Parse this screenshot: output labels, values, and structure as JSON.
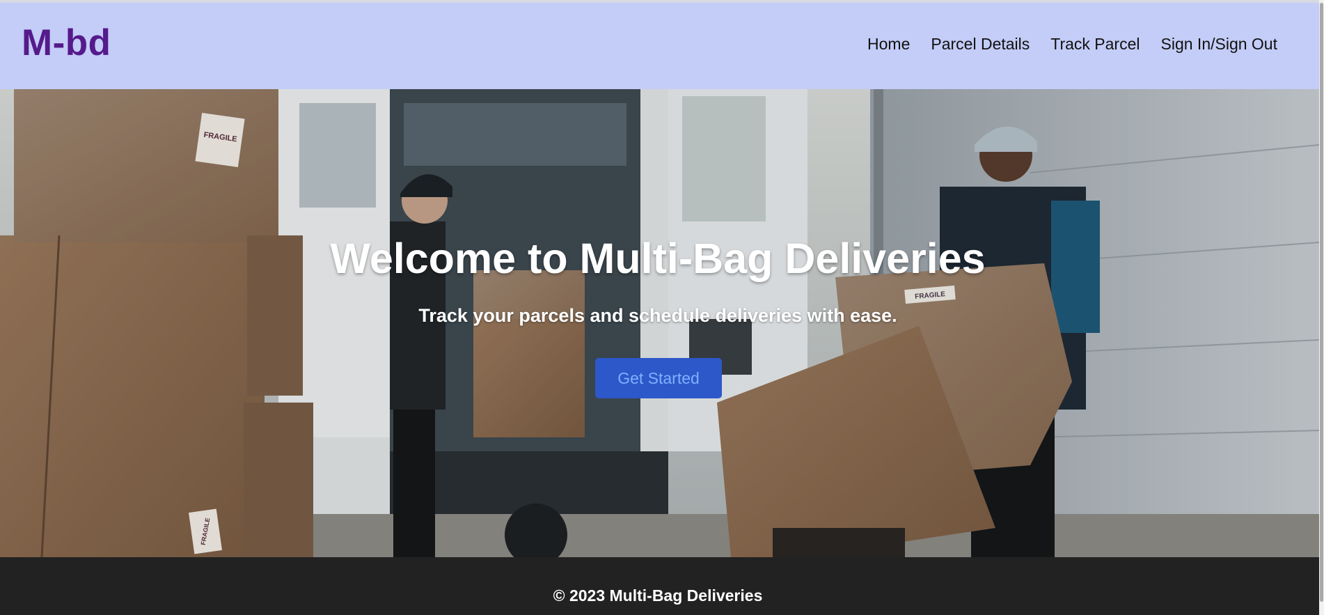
{
  "brand": {
    "name": "M-bd"
  },
  "nav": {
    "items": [
      {
        "label": "Home"
      },
      {
        "label": "Parcel Details"
      },
      {
        "label": "Track Parcel"
      },
      {
        "label": "Sign In/Sign Out"
      }
    ]
  },
  "hero": {
    "title": "Welcome to Multi-Bag Deliveries",
    "subtitle": "Track your parcels and schedule deliveries with ease.",
    "cta_label": "Get Started",
    "box_label": "FRAGILE"
  },
  "footer": {
    "text": "© 2023 Multi-Bag Deliveries"
  },
  "colors": {
    "navbar_bg": "#c3cdf7",
    "brand": "#551a8b",
    "cta_bg": "#2d58c9",
    "cta_text": "#7fb0ff",
    "footer_bg": "#222222"
  }
}
